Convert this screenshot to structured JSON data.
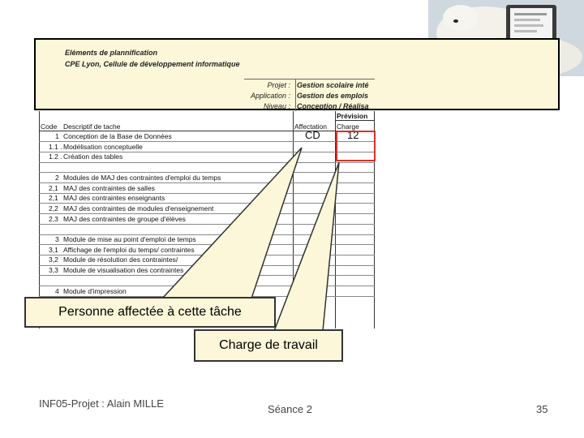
{
  "header": {
    "title_line1": "Eléments de plannification",
    "title_line2": "CPE Lyon, Cellule de développement informatique",
    "rows": [
      {
        "label": "Projet :",
        "value": "Gestion scolaire inté"
      },
      {
        "label": "Application :",
        "value": "Gestion des emplois"
      },
      {
        "label": "Niveau :",
        "value": "Conception / Réalisa"
      }
    ]
  },
  "sheet": {
    "prevision_header": "Prévision",
    "col_code": "Code",
    "col_desc": "Descriptif de tache",
    "col_affectation": "Affectation",
    "col_charge": "Charge",
    "rows": [
      {
        "code": "1",
        "desc": "Conception de la Base de Données",
        "affect": "CD",
        "charge": "12"
      },
      {
        "code": "1.1 .",
        "desc": "Modélisation conceptuelle",
        "affect": "",
        "charge": ""
      },
      {
        "code": "1.2 .",
        "desc": "Création des tables",
        "affect": "",
        "charge": ""
      },
      {
        "code": "",
        "desc": "",
        "affect": "",
        "charge": ""
      },
      {
        "code": "2",
        "desc": "Modules de MAJ des contraintes d'emploi du temps",
        "affect": "",
        "charge": ""
      },
      {
        "code": "2,1",
        "desc": "MAJ des contraintes de salles",
        "affect": "",
        "charge": ""
      },
      {
        "code": "2,1",
        "desc": "MAJ des contraintes enseignants",
        "affect": "",
        "charge": ""
      },
      {
        "code": "2,2",
        "desc": "MAJ des contraintes de modules d'enseignement",
        "affect": "",
        "charge": ""
      },
      {
        "code": "2,3",
        "desc": "MAJ des contraintes de groupe d'élèves",
        "affect": "",
        "charge": ""
      },
      {
        "code": "",
        "desc": "",
        "affect": "",
        "charge": ""
      },
      {
        "code": "3",
        "desc": "Module de mise au point d'emploi de temps",
        "affect": "",
        "charge": ""
      },
      {
        "code": "3,1",
        "desc": "Affichage de l'emploi du temps/ contraintes",
        "affect": "",
        "charge": ""
      },
      {
        "code": "3,2",
        "desc": "Module de résolution des contraintes/",
        "affect": "",
        "charge": ""
      },
      {
        "code": "3,3",
        "desc": "Module de visualisation des contraintes",
        "affect": "",
        "charge": ""
      },
      {
        "code": "",
        "desc": "",
        "affect": "",
        "charge": ""
      },
      {
        "code": "4",
        "desc": "Module d'impression",
        "affect": "",
        "charge": ""
      }
    ]
  },
  "callouts": {
    "person": "Personne affectée à cette tâche",
    "workload": "Charge de travail"
  },
  "footer": {
    "left": "INF05-Projet : Alain MILLE",
    "center": "Séance 2",
    "right": "35"
  },
  "colors": {
    "callout_bg": "#fbf7d8",
    "highlight": "#d9312b"
  }
}
